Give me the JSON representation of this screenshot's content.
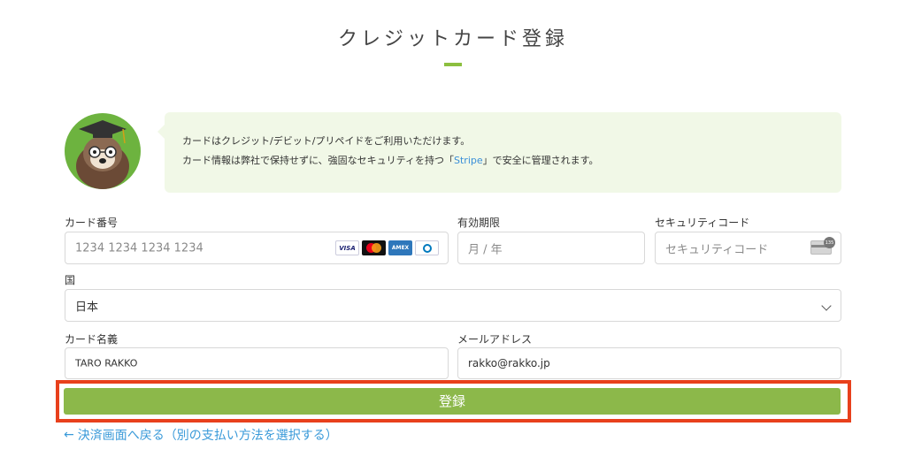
{
  "header": {
    "title": "クレジットカード登録"
  },
  "info": {
    "line1": "カードはクレジット/デビット/プリペイドをご利用いただけます。",
    "line2_prefix": "カード情報は弊社で保持せずに、強固なセキュリティを持つ「",
    "line2_brand": "Stripe",
    "line2_suffix": "」で安全に管理されます。"
  },
  "form": {
    "card_number": {
      "label": "カード番号",
      "placeholder": "1234 1234 1234 1234",
      "brand_icons": [
        "visa-icon",
        "mastercard-icon",
        "amex-icon",
        "diners-icon"
      ],
      "visa_text": "VISA",
      "amex_text": "AMEX"
    },
    "expiry": {
      "label": "有効期限",
      "placeholder": "月 / 年"
    },
    "cvc": {
      "label": "セキュリティコード",
      "placeholder": "セキュリティコード",
      "icon": "cvc-card-icon",
      "badge": "135"
    },
    "country": {
      "label": "国",
      "value": "日本"
    },
    "name": {
      "label": "カード名義",
      "value": "TARO RAKKO"
    },
    "email": {
      "label": "メールアドレス",
      "value": "rakko@rakko.jp"
    },
    "submit_label": "登録"
  },
  "back_link": {
    "arrow": "←",
    "label": "決済画面へ戻る（別の支払い方法を選択する）"
  },
  "colors": {
    "accent_green": "#8cb84a",
    "highlight_red": "#e8401c",
    "link_blue": "#3a9ad9",
    "info_bg": "#f1f8e7"
  }
}
